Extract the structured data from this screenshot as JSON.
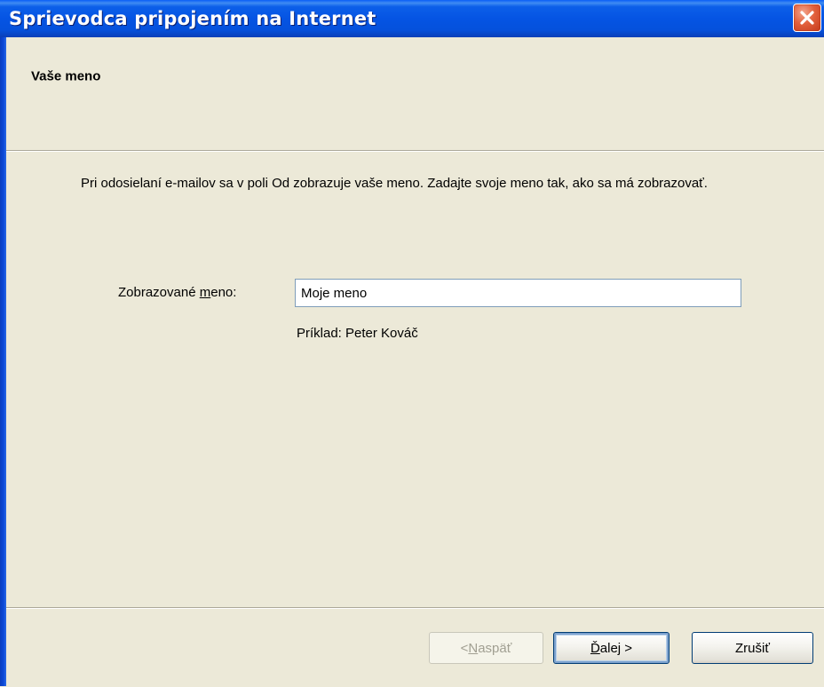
{
  "window": {
    "title": "Sprievodca pripojením na Internet"
  },
  "header": {
    "page_title": "Vaše meno"
  },
  "content": {
    "instruction": "Pri odosielaní e-mailov sa v poli Od zobrazuje vaše meno. Zadajte svoje meno tak, ako sa má zobrazovať.",
    "display_name_label_before": "Zobrazované ",
    "display_name_label_underlined": "m",
    "display_name_label_after": "eno:",
    "display_name_value": "Moje meno",
    "example": "Príklad: Peter Kováč"
  },
  "buttons": {
    "back_prefix": "< ",
    "back_underlined": "N",
    "back_rest": "aspäť",
    "back_enabled": false,
    "next_underlined": "Ď",
    "next_rest": "alej >",
    "cancel_label": "Zrušiť"
  },
  "icons": {
    "close": "close-x-icon"
  },
  "colors": {
    "titlebar": "#0554e3",
    "close_button": "#e2603c",
    "face": "#ece9d8"
  }
}
